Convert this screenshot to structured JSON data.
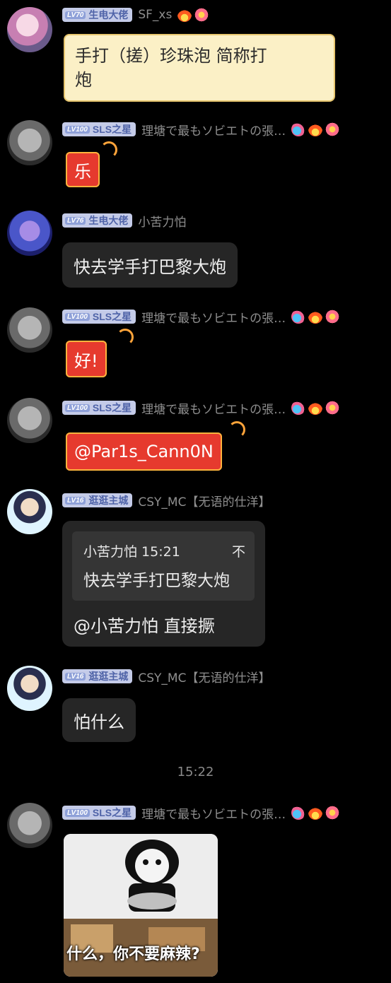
{
  "messages": [
    {
      "badge_lv": "LV70",
      "badge_title": "生电大佬",
      "nick": "SF_xs",
      "text_line1": "手打（搓）珍珠泡 简称打",
      "text_line2": "炮"
    },
    {
      "badge_lv": "LV100",
      "badge_title": "SLS之星",
      "nick": "理塘で最もソビエトの張…",
      "text": "乐"
    },
    {
      "badge_lv": "LV76",
      "badge_title": "生电大佬",
      "nick": "小苦力怕",
      "text": "快去学手打巴黎大炮"
    },
    {
      "badge_lv": "LV100",
      "badge_title": "SLS之星",
      "nick": "理塘で最もソビエトの張…",
      "text": "好!"
    },
    {
      "badge_lv": "LV100",
      "badge_title": "SLS之星",
      "nick": "理塘で最もソビエトの張…",
      "text": "@Par1s_Cann0N"
    },
    {
      "badge_lv": "LV16",
      "badge_title": "逛逛主城",
      "nick": "CSY_MC【无语的仕洋】",
      "quote_header": "小苦力怕 15:21",
      "quote_tail": "不",
      "quote_text": "快去学手打巴黎大炮",
      "text": "@小苦力怕 直接撅"
    },
    {
      "badge_lv": "LV16",
      "badge_title": "逛逛主城",
      "nick": "CSY_MC【无语的仕洋】",
      "text": "怕什么"
    },
    {
      "badge_lv": "LV100",
      "badge_title": "SLS之星",
      "nick": "理塘で最もソビエトの張…",
      "meme_caption": "什么，你不要麻辣?"
    }
  ],
  "timestamp": "15:22",
  "icons": {
    "fire": "fire-icon",
    "flower": "flower-icon",
    "dragon": "dragon-icon"
  }
}
